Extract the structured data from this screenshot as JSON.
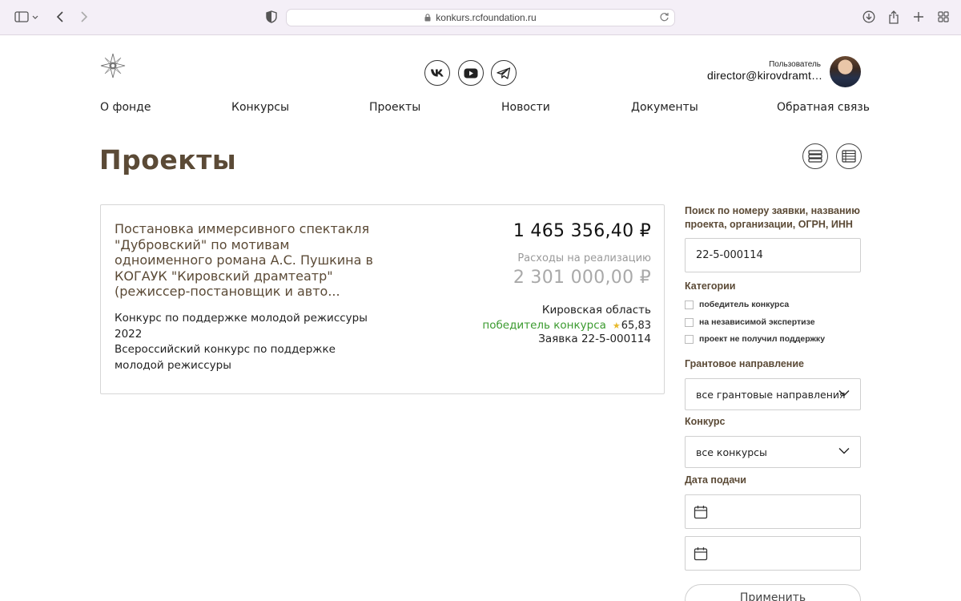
{
  "browser": {
    "url": "konkurs.rcfoundation.ru"
  },
  "header": {
    "user_label": "Пользователь",
    "user_email": "director@kirovdramteatr.ru",
    "social": [
      "vk-icon",
      "youtube-icon",
      "telegram-icon"
    ]
  },
  "nav": {
    "items": [
      {
        "label": "О фонде"
      },
      {
        "label": "Конкурсы"
      },
      {
        "label": "Проекты"
      },
      {
        "label": "Новости"
      },
      {
        "label": "Документы"
      },
      {
        "label": "Обратная связь"
      }
    ]
  },
  "page": {
    "title": "Проекты"
  },
  "project": {
    "title": "Постановка иммерсивного спектакля \"Дубровский\" по мотивам одноименного романа А.С. Пушкина в КОГАУК \"Кировский драмтеатр\" (режиссер-постановщик и авто...",
    "competition_1": "Конкурс по поддержке молодой режиссуры 2022",
    "competition_2": "Всероссийский конкурс по поддержке молодой режиссуры",
    "amount": "1 465 356,40 ₽",
    "expense_label": "Расходы на реализацию",
    "expense_value": "2 301 000,00 ₽",
    "region": "Кировская область",
    "status": "победитель конкурса",
    "score": "65,83",
    "application": "Заявка 22-5-000114"
  },
  "filters": {
    "search_label": "Поиск по номеру заявки, названию проекта, организации, ОГРН, ИНН",
    "search_value": "22-5-000114",
    "categories_label": "Категории",
    "categories": [
      {
        "label": "победитель конкурса",
        "checked": false
      },
      {
        "label": "на независимой экспертизе",
        "checked": false
      },
      {
        "label": "проект не получил поддержку",
        "checked": false
      }
    ],
    "grant_label": "Грантовое направление",
    "grant_value": "все грантовые направления",
    "contest_label": "Конкурс",
    "contest_value": "все конкурсы",
    "date_label": "Дата подачи",
    "apply_label": "Применить"
  },
  "colors": {
    "brand_brown": "#5b4a36",
    "status_green": "#3a9a2e",
    "star_yellow": "#e8b92b"
  }
}
